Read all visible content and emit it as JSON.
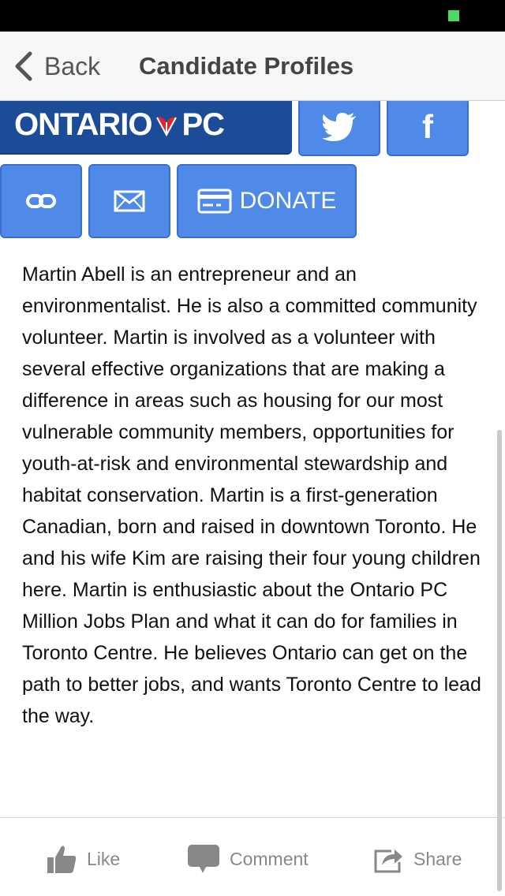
{
  "nav": {
    "back_label": "Back",
    "title": "Candidate Profiles"
  },
  "logo": {
    "left_text": "ONTARIO",
    "right_text": "PC"
  },
  "buttons": {
    "twitter_icon": "twitter-icon",
    "facebook_glyph": "f",
    "link_icon": "link-icon",
    "email_icon": "envelope-icon",
    "donate_label": "DONATE"
  },
  "bio": "Martin Abell is an entrepreneur and an environmentalist. He is also a committed community volunteer. Martin is involved as a volunteer with several effective organizations that are making a difference in areas such as housing for our most vulnerable community members, opportunities for youth-at-risk and environmental stewardship and habitat conservation. Martin is a first-generation Canadian, born and raised in downtown Toronto. He and his wife Kim are raising their four young children here. Martin is enthusiastic about the Ontario PC Million Jobs Plan and what it can do for families in Toronto Centre. He believes Ontario can get on the path to better jobs, and wants Toronto Centre to lead the way.",
  "actions": {
    "like": "Like",
    "comment": "Comment",
    "share": "Share"
  },
  "colors": {
    "button_blue": "#4f8ae8",
    "logo_navy": "#1c4c97",
    "trillium_red": "#e0262b",
    "status_green": "#4cd964"
  }
}
